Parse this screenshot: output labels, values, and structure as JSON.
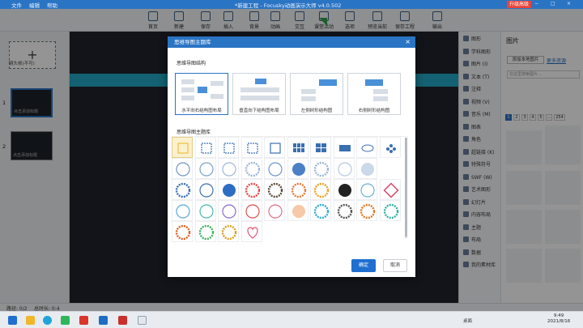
{
  "titlebar": {
    "menu": [
      "文件",
      "编辑",
      "帮助"
    ],
    "title": "*新建工程 - Focusky动画演示大师 v4.0.502",
    "upgrade": "升级高级",
    "window_controls": [
      "−",
      "□",
      "×"
    ]
  },
  "toolbar": {
    "items": [
      "首页",
      "新建",
      "保存",
      "插入",
      "背景",
      "动画",
      "交互",
      "课堂活动",
      "选项",
      "预览当前",
      "保存工程",
      "输出"
    ]
  },
  "left_panel": {
    "lens_label": "镜头帧(不可)",
    "slides": [
      {
        "num": "1",
        "caption": "点击添加标题"
      },
      {
        "num": "2",
        "caption": "点击添加标题"
      }
    ]
  },
  "right_panel": {
    "items": [
      "图形",
      "学科图形",
      "图片 (I)",
      "文本 (T)",
      "注释",
      "视频 (V)",
      "音乐 (M)",
      "图表",
      "角色",
      "超链接 (K)",
      "特殊符号",
      "SWF (W)",
      "艺术图形",
      "幻灯片",
      "内容布局",
      "主题",
      "布局",
      "数据",
      "我的素材库"
    ],
    "image_panel": {
      "title": "图片",
      "add_local": "添加本地图片",
      "more": "更多资源",
      "search_placeholder": "在这里搜索图片...",
      "pages": [
        "1",
        "2",
        "3",
        "4",
        "5",
        "...",
        "254"
      ]
    }
  },
  "statusbar": {
    "path": "路径: 0/2",
    "duration": "总时长: 0:4"
  },
  "taskbar": {
    "desktop": "桌面",
    "time": "9:49",
    "date": "2021/8/16"
  },
  "dialog": {
    "title": "思维导图主题库",
    "close": "×",
    "structure_heading": "思维导图结构",
    "layouts": [
      "水平向右结构图布局",
      "垂直向下结构图布局",
      "左侧树形结构图",
      "右侧树形结构图"
    ],
    "library_heading": "思维导图主题库",
    "ok": "确定",
    "cancel": "取消"
  },
  "colors": {
    "accent": "#2a74c4",
    "banner": "#22a7c5",
    "selected_cell": "#fbf0cf"
  }
}
